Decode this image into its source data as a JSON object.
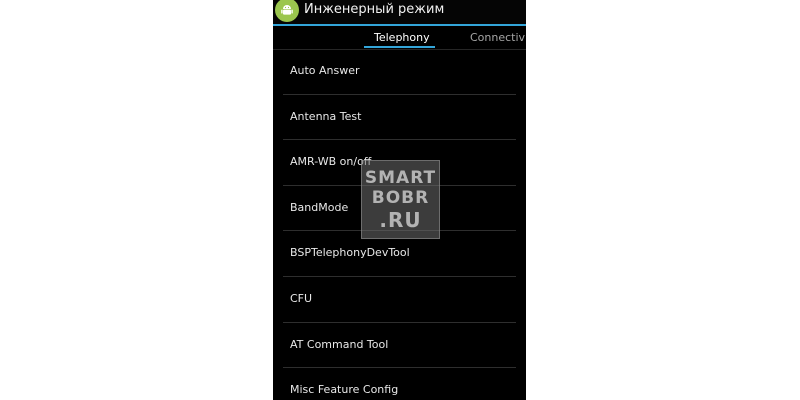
{
  "app": {
    "title": "Инженерный режим",
    "icon": "android-robot-icon"
  },
  "colors": {
    "background": "#000000",
    "accent": "#33a5d9",
    "icon_green": "#9bc64e"
  },
  "tabs": [
    {
      "label": "Telephony",
      "selected": true
    },
    {
      "label": "Connectivit",
      "selected": false
    }
  ],
  "list": {
    "items": [
      {
        "label": "Auto Answer"
      },
      {
        "label": "Antenna Test"
      },
      {
        "label": "AMR-WB on/off"
      },
      {
        "label": "BandMode"
      },
      {
        "label": "BSPTelephonyDevTool"
      },
      {
        "label": "CFU"
      },
      {
        "label": "AT Command Tool"
      },
      {
        "label": "Misc Feature Config"
      }
    ]
  },
  "watermark": {
    "line1": "SMART",
    "line2": "BOBR",
    "line3": ".RU"
  }
}
